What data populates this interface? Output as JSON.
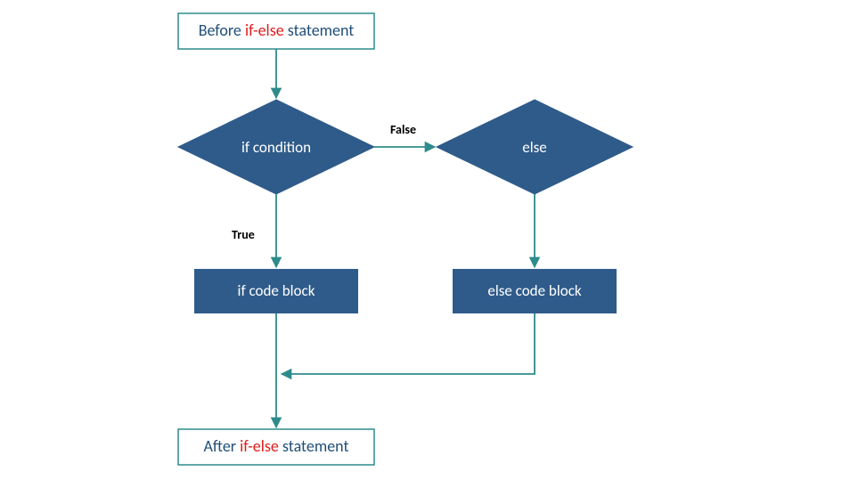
{
  "nodes": {
    "before_prefix": "Before ",
    "before_highlight": "if-else",
    "before_suffix": " statement",
    "if_condition": "if condition",
    "else_label": "else",
    "if_block": "if code block",
    "else_block": "else code block",
    "after_prefix": "After ",
    "after_highlight": "if-else",
    "after_suffix": " statement"
  },
  "edges": {
    "true_label": "True",
    "false_label": "False"
  },
  "colors": {
    "teal": "#2e8b8b",
    "navy": "#2f5b8a",
    "red": "#e01b1b",
    "darkblue_text": "#1f4e79"
  }
}
